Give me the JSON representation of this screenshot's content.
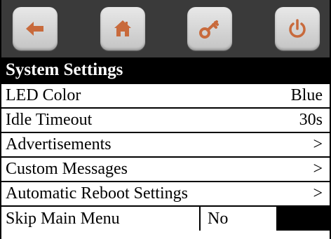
{
  "toolbar": {
    "buttons": [
      {
        "icon": "back-arrow-icon"
      },
      {
        "icon": "home-icon"
      },
      {
        "icon": "key-icon"
      },
      {
        "icon": "power-icon"
      }
    ],
    "background": "#3a3a3a",
    "icon_color": "#c86a3c"
  },
  "title": "System Settings",
  "settings": [
    {
      "label": "LED Color",
      "value": "Blue"
    },
    {
      "label": "Idle Timeout",
      "value": "30s"
    },
    {
      "label": "Advertisements",
      "value": ">"
    },
    {
      "label": "Custom Messages",
      "value": ">"
    },
    {
      "label": "Automatic Reboot Settings",
      "value": ">"
    }
  ],
  "skip_main_menu": {
    "label": "Skip Main Menu",
    "value": "No"
  }
}
